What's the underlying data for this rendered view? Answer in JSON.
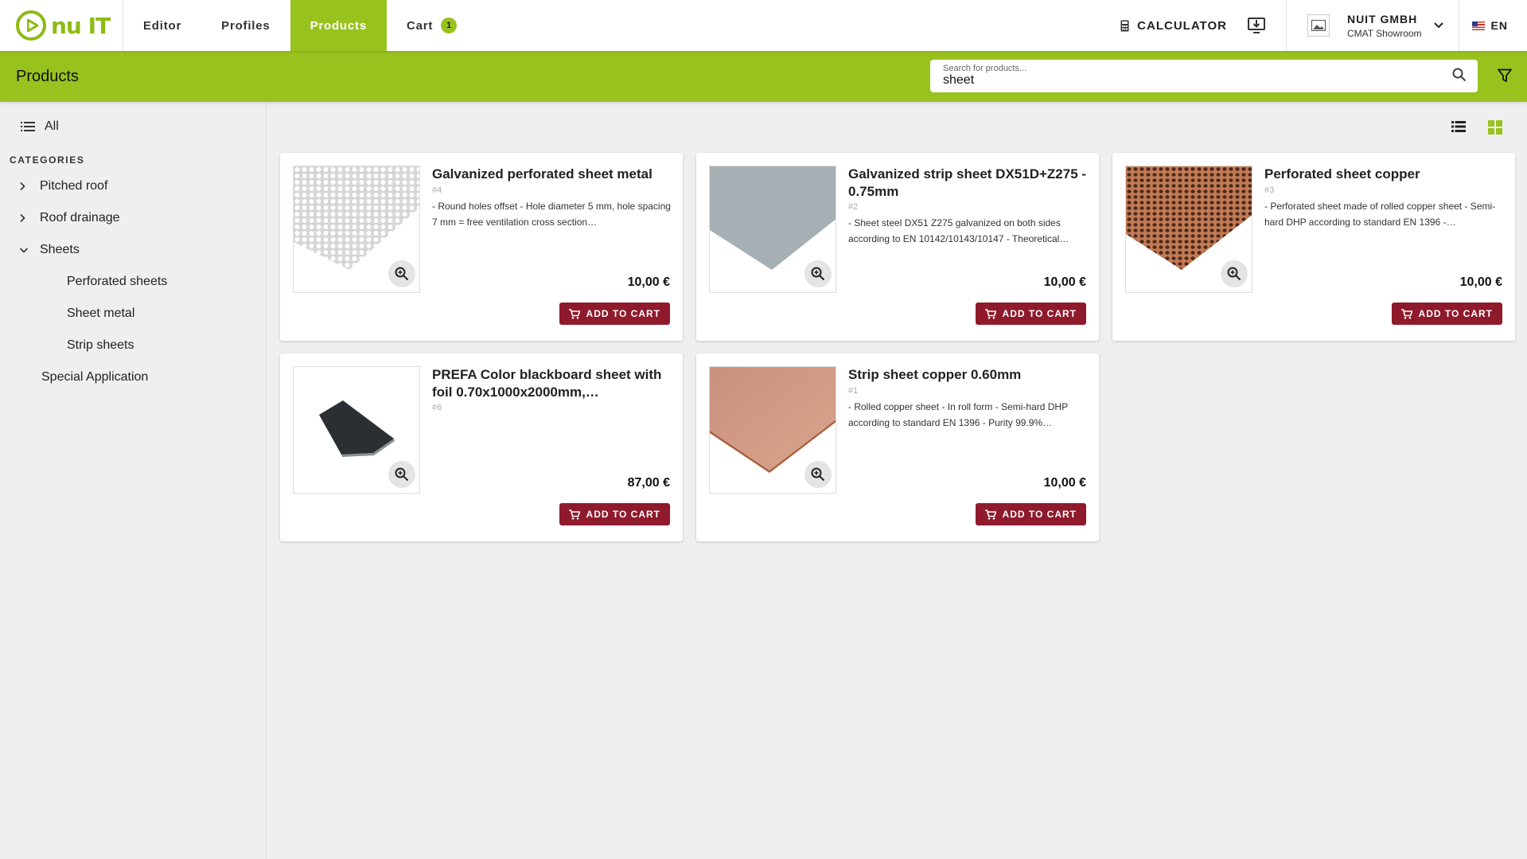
{
  "brand": {
    "logo_text": "nu IT",
    "accent": "#98c21d",
    "button_color": "#8f1a2c"
  },
  "nav": {
    "items": [
      {
        "label": "Editor"
      },
      {
        "label": "Profiles"
      },
      {
        "label": "Products"
      },
      {
        "label": "Cart"
      }
    ],
    "active": "Products",
    "cart_count": "1"
  },
  "toolbar": {
    "calculator_label": "CALCULATOR",
    "calculator_icon": "calculator-icon",
    "download_icon": "download-icon"
  },
  "company": {
    "name": "NUIT GMBH",
    "sub": "CMAT Showroom",
    "dropdown_icon": "chevron-down-icon"
  },
  "language": {
    "code": "EN",
    "flag": "us-flag-icon"
  },
  "header": {
    "title": "Products",
    "search_label": "Search for products...",
    "search_value": "sheet",
    "search_icon": "search-icon",
    "filter_icon": "filter-icon"
  },
  "sidebar": {
    "all_label": "All",
    "categories_title": "CATEGORIES",
    "categories": [
      {
        "label": "Pitched roof",
        "state": "collapsed"
      },
      {
        "label": "Roof drainage",
        "state": "collapsed"
      },
      {
        "label": "Sheets",
        "state": "expanded"
      },
      {
        "label": "Perforated sheets",
        "state": "child"
      },
      {
        "label": "Sheet metal",
        "state": "child"
      },
      {
        "label": "Strip sheets",
        "state": "child"
      },
      {
        "label": "Special Application",
        "state": "leaf"
      }
    ]
  },
  "view": {
    "list_icon": "list-view-icon",
    "grid_icon": "grid-view-icon",
    "active": "grid"
  },
  "products": [
    {
      "title": "Galvanized perforated sheet metal",
      "id": "#4",
      "description": "- Round holes offset - Hole diameter 5 mm, hole spacing 7 mm = free ventilation cross section…",
      "price": "10,00 €",
      "button": "ADD TO CART",
      "image": "galvanized-perforated-sheet"
    },
    {
      "title": "Galvanized strip sheet DX51D+Z275 - 0.75mm",
      "id": "#2",
      "description": "- Sheet steel DX51 Z275 galvanized on both sides according to EN 10142/10143/10147 - Theoretical…",
      "price": "10,00 €",
      "button": "ADD TO CART",
      "image": "galvanized-strip-sheet"
    },
    {
      "title": "Perforated sheet copper",
      "id": "#3",
      "description": "- Perforated sheet made of rolled copper sheet - Semi-hard DHP according to standard EN 1396 -…",
      "price": "10,00 €",
      "button": "ADD TO CART",
      "image": "perforated-copper-sheet"
    },
    {
      "title": "PREFA Color blackboard sheet with foil 0.70x1000x2000mm,…",
      "id": "#6",
      "description": "",
      "price": "87,00 €",
      "button": "ADD TO CART",
      "image": "prefa-blackboard-sheet"
    },
    {
      "title": "Strip sheet copper 0.60mm",
      "id": "#1",
      "description": "- Rolled copper sheet - In roll form - Semi-hard DHP according to standard EN 1396 - Purity 99.9%…",
      "price": "10,00 €",
      "button": "ADD TO CART",
      "image": "copper-strip-sheet"
    }
  ]
}
